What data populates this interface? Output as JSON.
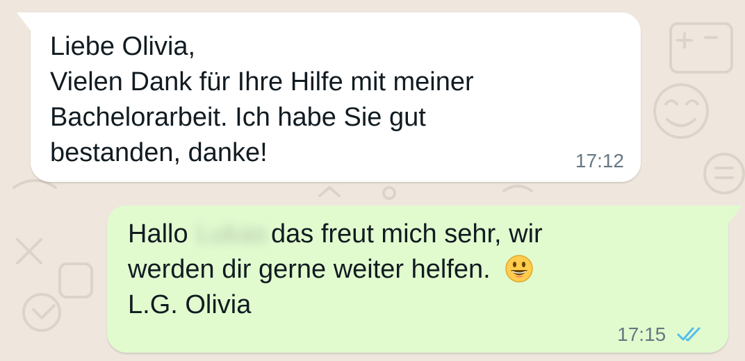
{
  "chat": {
    "incoming": {
      "lines": [
        "Liebe Olivia,",
        "Vielen Dank für Ihre Hilfe mit meiner",
        "Bachelorarbeit. Ich habe Sie gut",
        "bestanden, danke!"
      ],
      "time": "17:12",
      "bubble_color": "#ffffff"
    },
    "outgoing": {
      "line_1_start": "Hallo",
      "line_1_redacted_name": "Lukas",
      "line_1_end": "das freut mich sehr, wir",
      "line_2": "werden dir gerne weiter helfen.",
      "line_2_icon": "grinning-face-emoji",
      "line_3": "L.G. Olivia",
      "time": "17:15",
      "status_icon": "double-check-read-icon",
      "status_color": "#53bdeb",
      "bubble_color": "#e1fbcf"
    }
  }
}
